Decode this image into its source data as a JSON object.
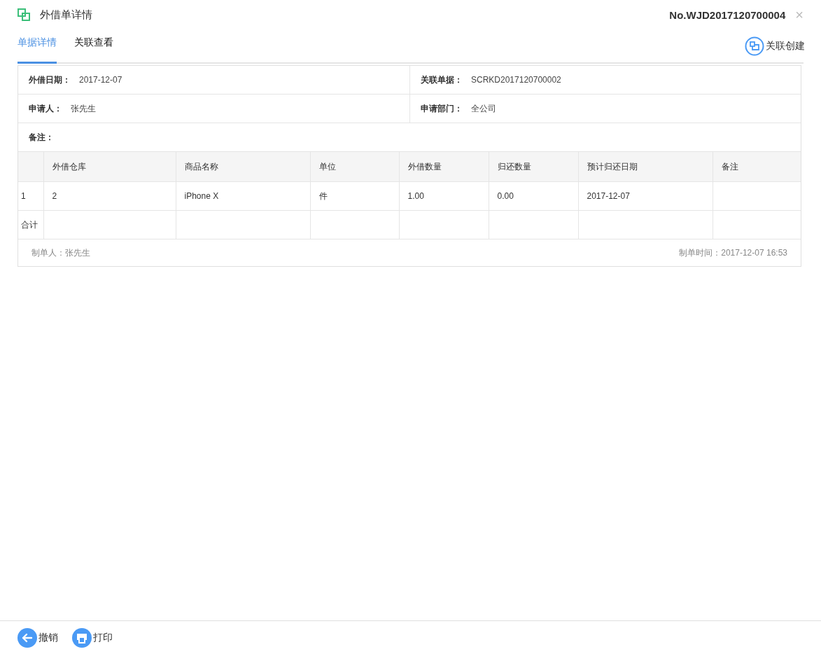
{
  "header": {
    "title": "外借单详情",
    "doc_no": "No.WJD2017120700004",
    "close": "×"
  },
  "tabs": [
    {
      "label": "单据详情",
      "selected": true
    },
    {
      "label": "关联查看",
      "selected": false
    }
  ],
  "link_create": "关联创建",
  "info_rows": [
    [
      {
        "label": "外借日期：",
        "value": "2017-12-07"
      },
      {
        "label": "关联单据：",
        "value": "SCRKD2017120700002"
      }
    ],
    [
      {
        "label": "申请人：",
        "value": "张先生"
      },
      {
        "label": "申请部门：",
        "value": "全公司"
      }
    ]
  ],
  "remark_label": "备注：",
  "table": {
    "columns": [
      "外借仓库",
      "商品名称",
      "单位",
      "外借数量",
      "归还数量",
      "预计归还日期",
      "备注"
    ],
    "rows": [
      {
        "index": "1",
        "cells": [
          "2",
          "iPhone X",
          "件",
          "1.00",
          "0.00",
          "2017-12-07",
          ""
        ]
      }
    ],
    "total_label": "合计"
  },
  "creator": "制单人：张先生",
  "created_time": "制单时间：2017-12-07 16:53",
  "actions": [
    {
      "kind": "back",
      "label": "撤销"
    },
    {
      "kind": "print",
      "label": "打印"
    }
  ]
}
